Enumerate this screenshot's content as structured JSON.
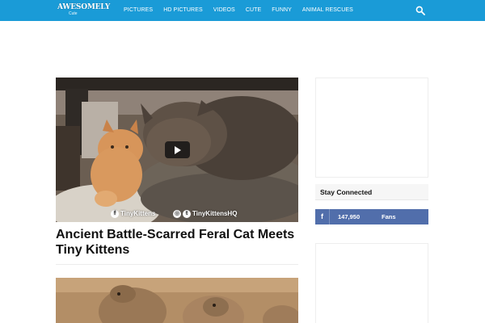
{
  "header": {
    "logo_main": "AWESOMELY",
    "logo_sub": "Cute",
    "nav": [
      "PICTURES",
      "HD PICTURES",
      "VIDEOS",
      "CUTE",
      "FUNNY",
      "ANIMAL RESCUES"
    ],
    "search_icon": "search-icon",
    "bar_color": "#1a9bd7"
  },
  "article": {
    "title": "Ancient Battle-Scarred Feral Cat Meets Tiny Kittens",
    "watermark_left": "TinyKittens",
    "watermark_right": "TinyKittensHQ",
    "play_icon": "play-icon"
  },
  "sidebar": {
    "stay_connected": "Stay Connected",
    "facebook": {
      "icon": "f",
      "count": "147,950",
      "label": "Fans",
      "color": "#516eab"
    }
  }
}
